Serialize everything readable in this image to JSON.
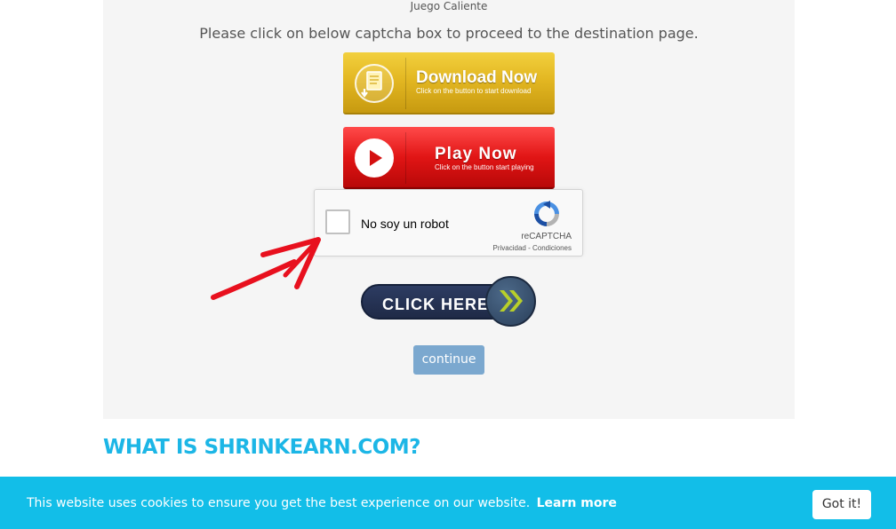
{
  "panel": {
    "top_title": "Juego Caliente",
    "instruction": "Please click on below captcha box to proceed to the destination page."
  },
  "ads": {
    "download": {
      "main": "Download Now",
      "sub": "Click on the button to start download",
      "icon": "document-download-icon",
      "color": "#e3b722"
    },
    "play": {
      "main": "Play Now",
      "sub": "Click on the button start playing",
      "icon": "play-icon",
      "color": "#e11515"
    }
  },
  "recaptcha": {
    "label": "No soy un robot",
    "brand": "reCAPTCHA",
    "links": "Privacidad - Condiciones",
    "checked": false
  },
  "click_here": {
    "label": "CLICK HERE",
    "icon": "double-chevron-right-icon"
  },
  "continue_button": {
    "label": "continue"
  },
  "section": {
    "heading": "WHAT IS SHRINKEARN.COM?"
  },
  "cookie": {
    "message": "This website uses cookies to ensure you get the best experience on our website.",
    "learn_more": "Learn more",
    "button": "Got it!"
  },
  "colors": {
    "accent": "#1cb6e6",
    "cookie_bar": "#12bee8",
    "continue": "#7ba8cf",
    "arrow": "#e8101e"
  }
}
